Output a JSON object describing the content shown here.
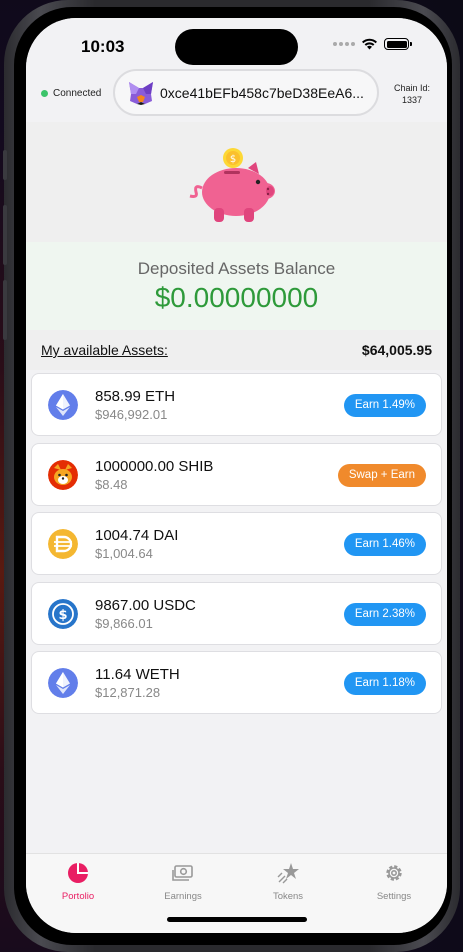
{
  "status": {
    "time": "10:03"
  },
  "wallet": {
    "status_label": "Connected",
    "address": "0xce41bEFb458c7beD38EeA6...",
    "chain_label": "Chain Id:",
    "chain_id": "1337"
  },
  "deposit": {
    "title": "Deposited Assets Balance",
    "value": "$0.00000000"
  },
  "assets": {
    "label": "My available Assets:",
    "total": "$64,005.95",
    "items": [
      {
        "amount": "858.99 ETH",
        "usd": "$946,992.01",
        "action": "Earn 1.49%",
        "icon": "eth-icon",
        "action_color": "#2196f3"
      },
      {
        "amount": "1000000.00 SHIB",
        "usd": "$8.48",
        "action": "Swap + Earn",
        "icon": "shib-icon",
        "action_color": "#f08a2c"
      },
      {
        "amount": "1004.74 DAI",
        "usd": "$1,004.64",
        "action": "Earn 1.46%",
        "icon": "dai-icon",
        "action_color": "#2196f3"
      },
      {
        "amount": "9867.00 USDC",
        "usd": "$9,866.01",
        "action": "Earn 2.38%",
        "icon": "usdc-icon",
        "action_color": "#2196f3"
      },
      {
        "amount": "11.64 WETH",
        "usd": "$12,871.28",
        "action": "Earn 1.18%",
        "icon": "weth-icon",
        "action_color": "#2196f3"
      }
    ]
  },
  "tabs": [
    {
      "label": "Portolio",
      "icon": "pie-chart-icon",
      "active": true
    },
    {
      "label": "Earnings",
      "icon": "cash-icon",
      "active": false
    },
    {
      "label": "Tokens",
      "icon": "stars-icon",
      "active": false
    },
    {
      "label": "Settings",
      "icon": "gear-icon",
      "active": false
    }
  ],
  "colors": {
    "accent_green": "#2e9a3a",
    "earn_blue": "#2196f3",
    "swap_orange": "#f08a2c",
    "active_tab": "#e91e63"
  }
}
